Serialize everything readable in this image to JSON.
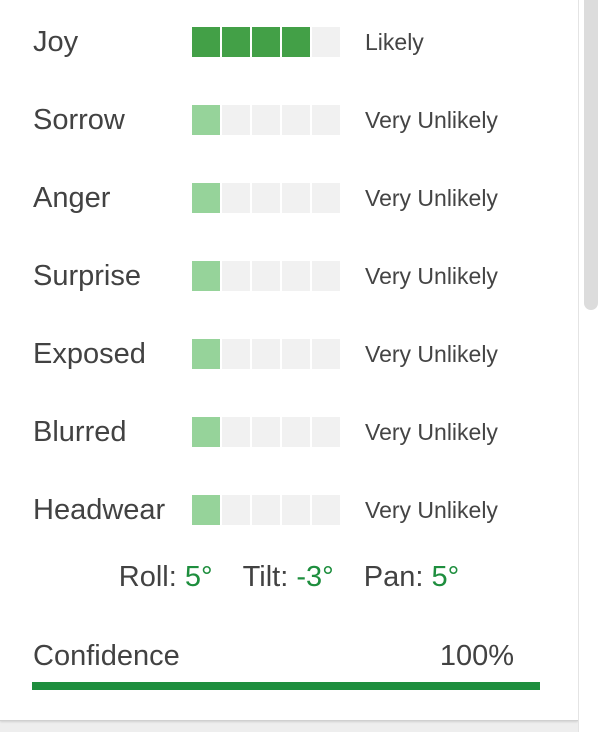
{
  "colors": {
    "strong_fill": "#43a047",
    "weak_fill": "#96d39a",
    "empty_fill": "#f1f1f1",
    "accent_green": "#1e8e3e"
  },
  "likelihood_rows": [
    {
      "label": "Joy",
      "likelihood": "Likely",
      "level": 4
    },
    {
      "label": "Sorrow",
      "likelihood": "Very Unlikely",
      "level": 1
    },
    {
      "label": "Anger",
      "likelihood": "Very Unlikely",
      "level": 1
    },
    {
      "label": "Surprise",
      "likelihood": "Very Unlikely",
      "level": 1
    },
    {
      "label": "Exposed",
      "likelihood": "Very Unlikely",
      "level": 1
    },
    {
      "label": "Blurred",
      "likelihood": "Very Unlikely",
      "level": 1
    },
    {
      "label": "Headwear",
      "likelihood": "Very Unlikely",
      "level": 1
    }
  ],
  "meter_segments": 5,
  "angles": {
    "roll_label": "Roll:",
    "roll_value": "5°",
    "tilt_label": "Tilt:",
    "tilt_value": "-3°",
    "pan_label": "Pan:",
    "pan_value": "5°"
  },
  "confidence": {
    "label": "Confidence",
    "value": "100%",
    "fraction": 1.0
  }
}
